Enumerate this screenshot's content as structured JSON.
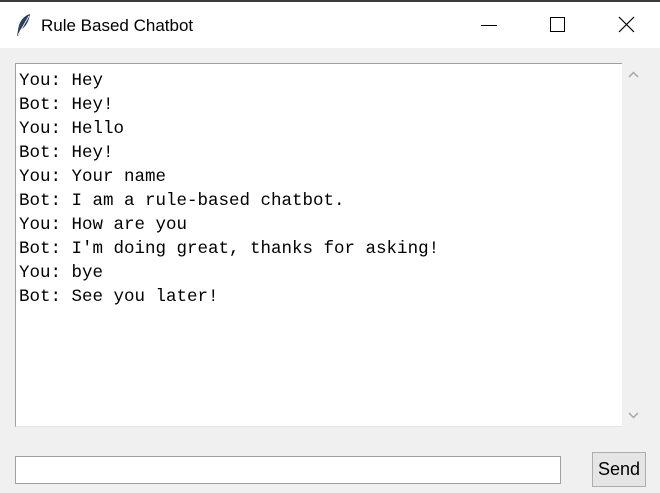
{
  "window": {
    "title": "Rule Based Chatbot",
    "icons": {
      "app": "feather-icon",
      "minimize": "minimize-icon",
      "maximize": "maximize-icon",
      "close": "close-icon"
    }
  },
  "chat": {
    "lines": [
      "You: Hey",
      "Bot: Hey!",
      "You: Hello",
      "Bot: Hey!",
      "You: Your name",
      "Bot: I am a rule-based chatbot.",
      "You: How are you",
      "Bot: I'm doing great, thanks for asking!",
      "You: bye",
      "Bot: See you later!"
    ]
  },
  "input": {
    "value": ""
  },
  "send_button": {
    "label": "Send"
  }
}
